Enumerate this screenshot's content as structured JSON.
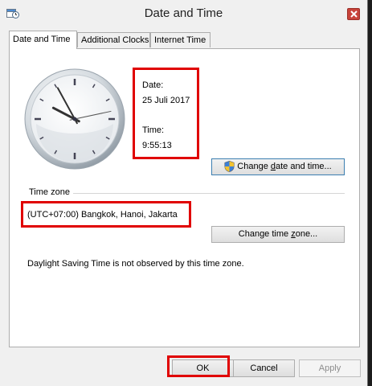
{
  "window": {
    "title": "Date and Time",
    "icon": "date-time-icon",
    "close": "close-icon"
  },
  "tabs": [
    {
      "label": "Date and Time",
      "active": true
    },
    {
      "label": "Additional Clocks",
      "active": false
    },
    {
      "label": "Internet Time",
      "active": false
    }
  ],
  "clock": {
    "icon": "analog-clock-icon",
    "hour": 9,
    "minute": 55,
    "second": 13
  },
  "date": {
    "label": "Date:",
    "value": "25 Juli 2017"
  },
  "time": {
    "label": "Time:",
    "value": "9:55:13"
  },
  "change_date_button": {
    "label_pre": "Change ",
    "label_key": "d",
    "label_post": "ate and time...",
    "icon": "uac-shield-icon"
  },
  "timezone": {
    "section_label": "Time zone",
    "value": "(UTC+07:00) Bangkok, Hanoi, Jakarta",
    "change_button": {
      "label_pre": "Change time ",
      "label_key": "z",
      "label_post": "one..."
    }
  },
  "dst_text": "Daylight Saving Time is not observed by this time zone.",
  "footer": {
    "ok": "OK",
    "cancel": "Cancel",
    "apply": "Apply"
  },
  "colors": {
    "highlight": "#e00000",
    "panel": "#ffffff",
    "dialog": "#f0f0f0"
  }
}
